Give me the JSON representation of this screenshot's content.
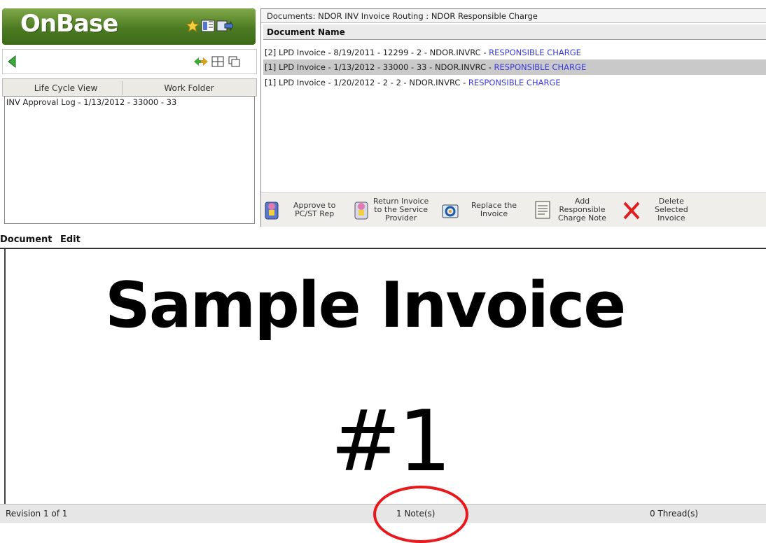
{
  "logo": {
    "text": "OnBase"
  },
  "left_tabs": [
    {
      "label": "Life Cycle View"
    },
    {
      "label": "Work Folder"
    }
  ],
  "work_folder": {
    "items": [
      "INV Approval Log - 1/13/2012 - 33000 - 33"
    ]
  },
  "documents_panel": {
    "header": "Documents: NDOR INV Invoice Routing : NDOR Responsible Charge",
    "column_header": "Document Name",
    "rows": [
      {
        "prefix": "[2] LPD Invoice - 8/19/2011 - 12299 - 2 - NDOR.INVRC - ",
        "tag": "RESPONSIBLE CHARGE"
      },
      {
        "prefix": "[1] LPD Invoice - 1/13/2012 - 33000 - 33 - NDOR.INVRC - ",
        "tag": "RESPONSIBLE CHARGE"
      },
      {
        "prefix": "[1] LPD Invoice - 1/20/2012 - 2 - 2 - NDOR.INVRC - ",
        "tag": "RESPONSIBLE CHARGE"
      }
    ]
  },
  "actions": [
    {
      "line1": "Approve to",
      "line2": "PC/ST Rep",
      "line3": "",
      "icon": "approve-icon"
    },
    {
      "line1": "Return Invoice",
      "line2": "to the Service",
      "line3": "Provider",
      "icon": "return-icon"
    },
    {
      "line1": "Replace the",
      "line2": "Invoice",
      "line3": "",
      "icon": "replace-icon"
    },
    {
      "line1": "Add",
      "line2": "Responsible",
      "line3": "Charge Note",
      "icon": "note-icon"
    },
    {
      "line1": "Delete",
      "line2": "Selected",
      "line3": "Invoice",
      "icon": "delete-icon"
    }
  ],
  "menu": {
    "document": "Document",
    "edit": "Edit"
  },
  "document": {
    "title": "Sample Invoice",
    "number": "#1"
  },
  "status": {
    "revision": "Revision 1 of 1",
    "notes": "1 Note(s)",
    "threads": "0 Thread(s)"
  },
  "colors": {
    "logo_green": "#5a8a2a",
    "link_blue": "#3a3adb",
    "highlight_red": "#e8181d",
    "delete_red": "#e02020"
  }
}
